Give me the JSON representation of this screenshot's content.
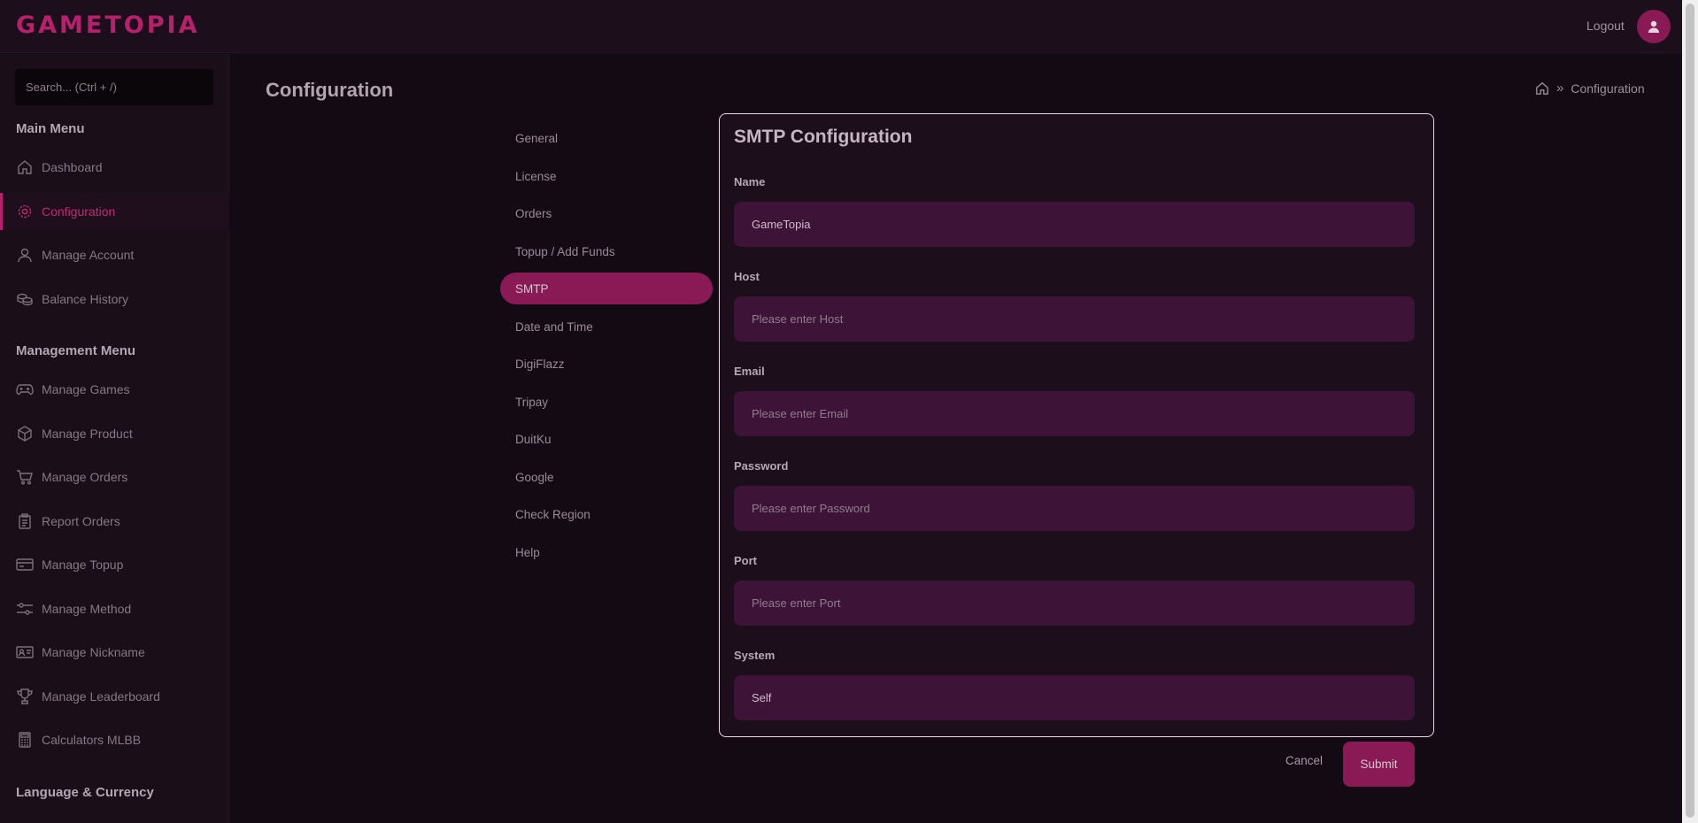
{
  "header": {
    "logo": "GAMETOPIA",
    "logout_label": "Logout",
    "brand_color": "#b6206c"
  },
  "sidebar": {
    "search_placeholder": "Search... (Ctrl + /)",
    "main_menu_heading": "Main Menu",
    "main_menu": [
      {
        "label": "Dashboard",
        "icon": "home-icon"
      },
      {
        "label": "Configuration",
        "icon": "gear-icon",
        "active": true
      },
      {
        "label": "Manage Account",
        "icon": "user-icon"
      },
      {
        "label": "Balance History",
        "icon": "coins-icon"
      }
    ],
    "management_menu_heading": "Management Menu",
    "management_menu": [
      {
        "label": "Manage Games",
        "icon": "gamepad-icon"
      },
      {
        "label": "Manage Product",
        "icon": "box-icon"
      },
      {
        "label": "Manage Orders",
        "icon": "cart-icon"
      },
      {
        "label": "Report Orders",
        "icon": "clipboard-icon"
      },
      {
        "label": "Manage Topup",
        "icon": "card-icon"
      },
      {
        "label": "Manage Method",
        "icon": "sliders-icon"
      },
      {
        "label": "Manage Nickname",
        "icon": "id-card-icon"
      },
      {
        "label": "Manage Leaderboard",
        "icon": "trophy-icon"
      },
      {
        "label": "Calculators MLBB",
        "icon": "calculator-icon"
      }
    ],
    "language_heading": "Language & Currency"
  },
  "main": {
    "page_title": "Configuration",
    "breadcrumb": {
      "current": "Configuration"
    },
    "config_tabs": [
      {
        "label": "General"
      },
      {
        "label": "License"
      },
      {
        "label": "Orders"
      },
      {
        "label": "Topup / Add Funds"
      },
      {
        "label": "SMTP",
        "active": true
      },
      {
        "label": "Date and Time"
      },
      {
        "label": "DigiFlazz"
      },
      {
        "label": "Tripay"
      },
      {
        "label": "DuitKu"
      },
      {
        "label": "Google"
      },
      {
        "label": "Check Region"
      },
      {
        "label": "Help"
      }
    ],
    "form": {
      "title": "SMTP Configuration",
      "fields": [
        {
          "label": "Name",
          "value": "GameTopia",
          "placeholder": ""
        },
        {
          "label": "Host",
          "value": "",
          "placeholder": "Please enter Host"
        },
        {
          "label": "Email",
          "value": "",
          "placeholder": "Please enter Email"
        },
        {
          "label": "Password",
          "value": "",
          "placeholder": "Please enter Password"
        },
        {
          "label": "Port",
          "value": "",
          "placeholder": "Please enter Port"
        },
        {
          "label": "System",
          "value": "Self",
          "placeholder": ""
        }
      ],
      "cancel_label": "Cancel",
      "submit_label": "Submit"
    }
  }
}
